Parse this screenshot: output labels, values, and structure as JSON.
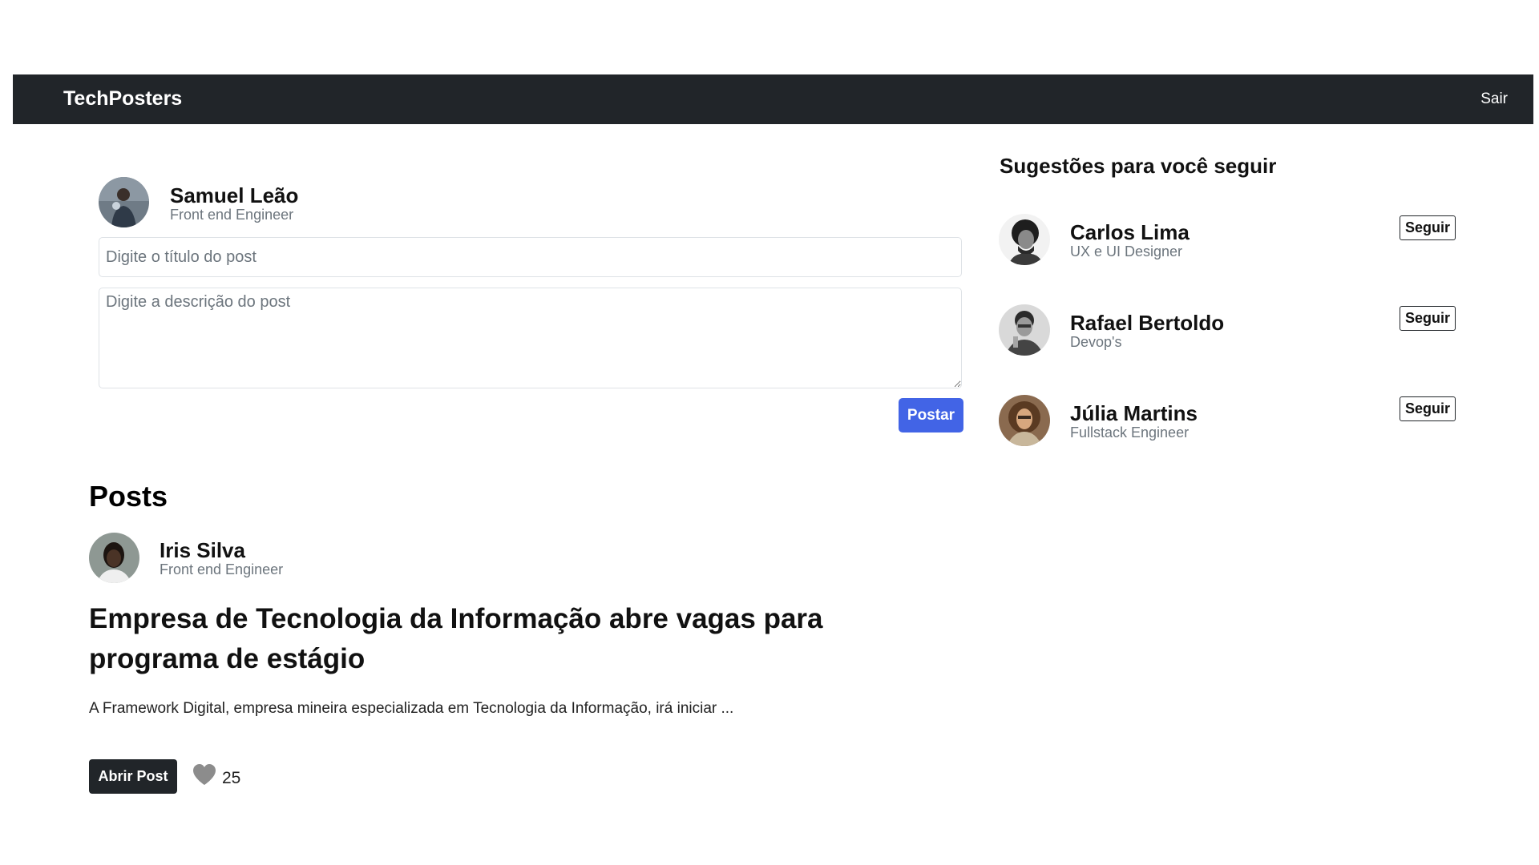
{
  "navbar": {
    "brand": "TechPosters",
    "logout_label": "Sair"
  },
  "composer": {
    "user": {
      "name": "Samuel Leão",
      "role": "Front end Engineer"
    },
    "title_placeholder": "Digite o título do post",
    "description_placeholder": "Digite a descrição do post",
    "post_button_label": "Postar",
    "accent_color": "#4264e6"
  },
  "suggestions": {
    "title": "Sugestões para você seguir",
    "follow_label": "Seguir",
    "people": [
      {
        "name": "Carlos Lima",
        "role": "UX e UI Designer"
      },
      {
        "name": "Rafael Bertoldo",
        "role": "Devop's"
      },
      {
        "name": "Júlia Martins",
        "role": "Fullstack Engineer"
      }
    ]
  },
  "posts": {
    "heading": "Posts",
    "items": [
      {
        "author": {
          "name": "Iris Silva",
          "role": "Front end Engineer"
        },
        "title": "Empresa de Tecnologia da Informação abre vagas para programa de estágio",
        "excerpt": "A Framework Digital, empresa mineira especializada em Tecnologia da Informação, irá iniciar ...",
        "open_label": "Abrir Post",
        "likes": "25",
        "like_icon": "heart-icon"
      }
    ]
  }
}
